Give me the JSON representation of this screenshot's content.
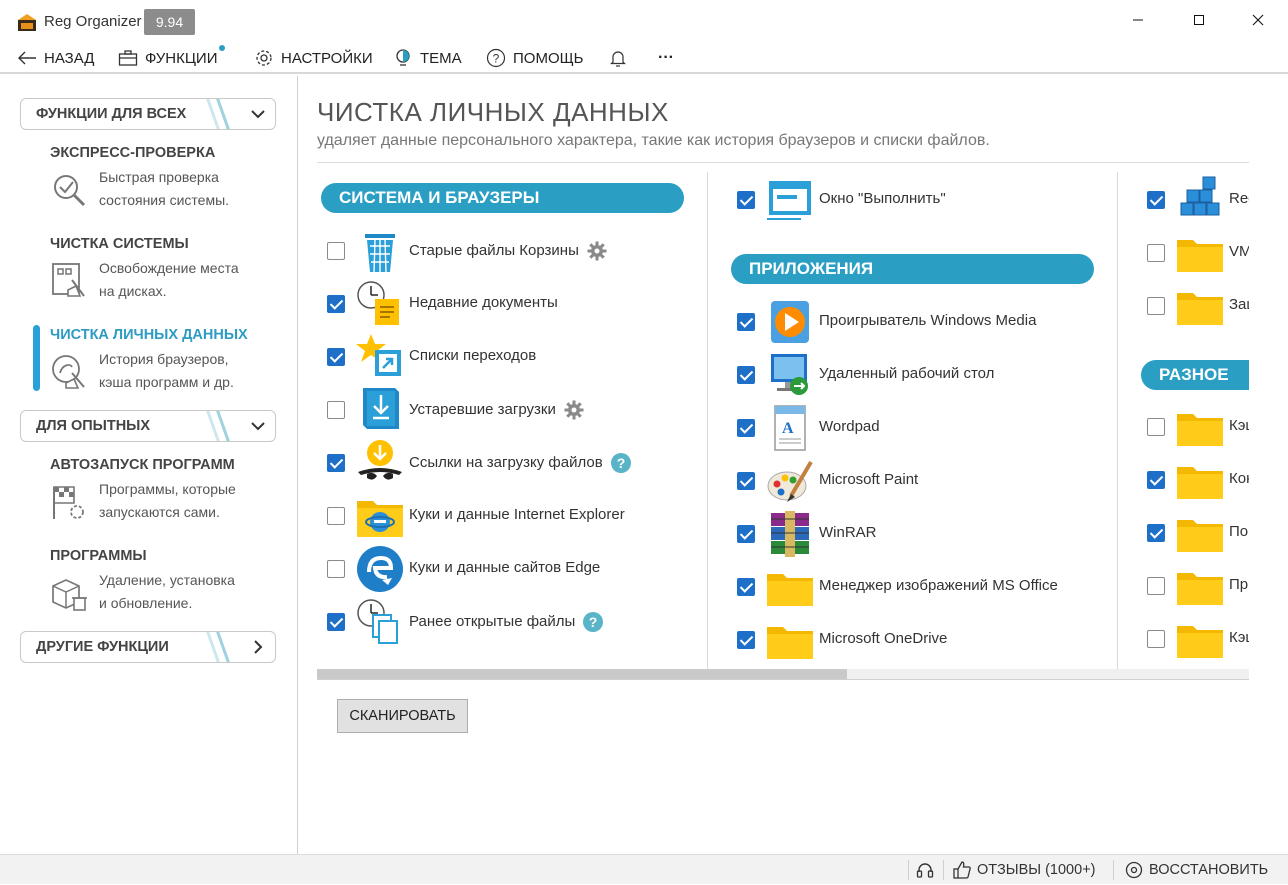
{
  "window": {
    "title": "Reg Organizer",
    "version": "9.94",
    "minimize_glyph": "–",
    "maximize_glyph": "□",
    "close_glyph": "✕"
  },
  "toolbar": {
    "back": "НАЗАД",
    "functions": "ФУНКЦИИ",
    "settings": "НАСТРОЙКИ",
    "theme": "ТЕМА",
    "help": "ПОМОЩЬ",
    "more": "···"
  },
  "sidebar": {
    "group_all": "ФУНКЦИИ ДЛЯ ВСЕХ",
    "express_title": "ЭКСПРЕСС-ПРОВЕРКА",
    "express_desc1": "Быстрая проверка",
    "express_desc2": "состояния системы.",
    "clean_title": "ЧИСТКА СИСТЕМЫ",
    "clean_desc1": "Освобождение места",
    "clean_desc2": "на дисках.",
    "private_title": "ЧИСТКА ЛИЧНЫХ ДАННЫХ",
    "private_desc1": "История браузеров,",
    "private_desc2": "кэша программ и др.",
    "group_pro": "ДЛЯ ОПЫТНЫХ",
    "autorun_title": "АВТОЗАПУСК ПРОГРАММ",
    "autorun_desc1": "Программы, которые",
    "autorun_desc2": "запускаются сами.",
    "programs_title": "ПРОГРАММЫ",
    "programs_desc1": "Удаление, установка",
    "programs_desc2": "и обновление.",
    "group_other": "ДРУГИЕ ФУНКЦИИ"
  },
  "main": {
    "title": "ЧИСТКА ЛИЧНЫХ ДАННЫХ",
    "subtitle": "удаляет данные персонального характера, такие как история браузеров и списки файлов.",
    "scan_button": "СКАНИРОВАТЬ"
  },
  "col1": {
    "header": "СИСТЕМА И БРАУЗЕРЫ",
    "items": [
      {
        "label": "Старые файлы Корзины",
        "checked": false,
        "icon": "recycle-bin-icon",
        "badge": "gear"
      },
      {
        "label": "Недавние документы",
        "checked": true,
        "icon": "recent-documents-icon",
        "badge": ""
      },
      {
        "label": "Списки переходов",
        "checked": true,
        "icon": "jump-lists-icon",
        "badge": ""
      },
      {
        "label": "Устаревшие загрузки",
        "checked": false,
        "icon": "downloads-icon",
        "badge": "gear"
      },
      {
        "label": "Ссылки на загрузку файлов",
        "checked": true,
        "icon": "download-links-icon",
        "badge": "help"
      },
      {
        "label": "Куки и данные Internet Explorer",
        "checked": false,
        "icon": "internet-explorer-icon",
        "badge": ""
      },
      {
        "label": "Куки и данные сайтов Edge",
        "checked": false,
        "icon": "edge-icon",
        "badge": ""
      },
      {
        "label": "Ранее открытые файлы",
        "checked": true,
        "icon": "recent-files-icon",
        "badge": "help"
      }
    ]
  },
  "col2": {
    "top_item": {
      "label": "Окно \"Выполнить\"",
      "checked": true,
      "icon": "run-dialog-icon"
    },
    "header": "ПРИЛОЖЕНИЯ",
    "items": [
      {
        "label": "Проигрыватель Windows Media",
        "checked": true,
        "icon": "windows-media-player-icon"
      },
      {
        "label": "Удаленный рабочий стол",
        "checked": true,
        "icon": "remote-desktop-icon"
      },
      {
        "label": "Wordpad",
        "checked": true,
        "icon": "wordpad-icon"
      },
      {
        "label": "Microsoft Paint",
        "checked": true,
        "icon": "paint-icon"
      },
      {
        "label": "WinRAR",
        "checked": true,
        "icon": "winrar-icon"
      },
      {
        "label": "Менеджер изображений MS Office",
        "checked": true,
        "icon": "folder-icon"
      },
      {
        "label": "Microsoft OneDrive",
        "checked": true,
        "icon": "folder-icon"
      }
    ]
  },
  "col3": {
    "top_items": [
      {
        "label": "Reg",
        "checked": true,
        "icon": "registry-cubes-icon"
      },
      {
        "label": "VM",
        "checked": false,
        "icon": "folder-icon"
      },
      {
        "label": "Заш",
        "checked": false,
        "icon": "folder-icon"
      }
    ],
    "header": "РАЗНОЕ",
    "items": [
      {
        "label": "Кэш",
        "checked": false,
        "icon": "folder-icon"
      },
      {
        "label": "Кон",
        "checked": true,
        "icon": "folder-icon"
      },
      {
        "label": "Поı",
        "checked": true,
        "icon": "folder-icon"
      },
      {
        "label": "Пр",
        "checked": false,
        "icon": "folder-icon"
      },
      {
        "label": "Кэш",
        "checked": false,
        "icon": "folder-icon"
      }
    ]
  },
  "status": {
    "reviews": "ОТЗЫВЫ (1000+)",
    "restore": "ВОССТАНОВИТЬ"
  },
  "colors": {
    "accent": "#2a9fc3",
    "checkbox": "#1e6fc8",
    "folder": "#ffc700",
    "active_bar": "#2aa0d8"
  }
}
